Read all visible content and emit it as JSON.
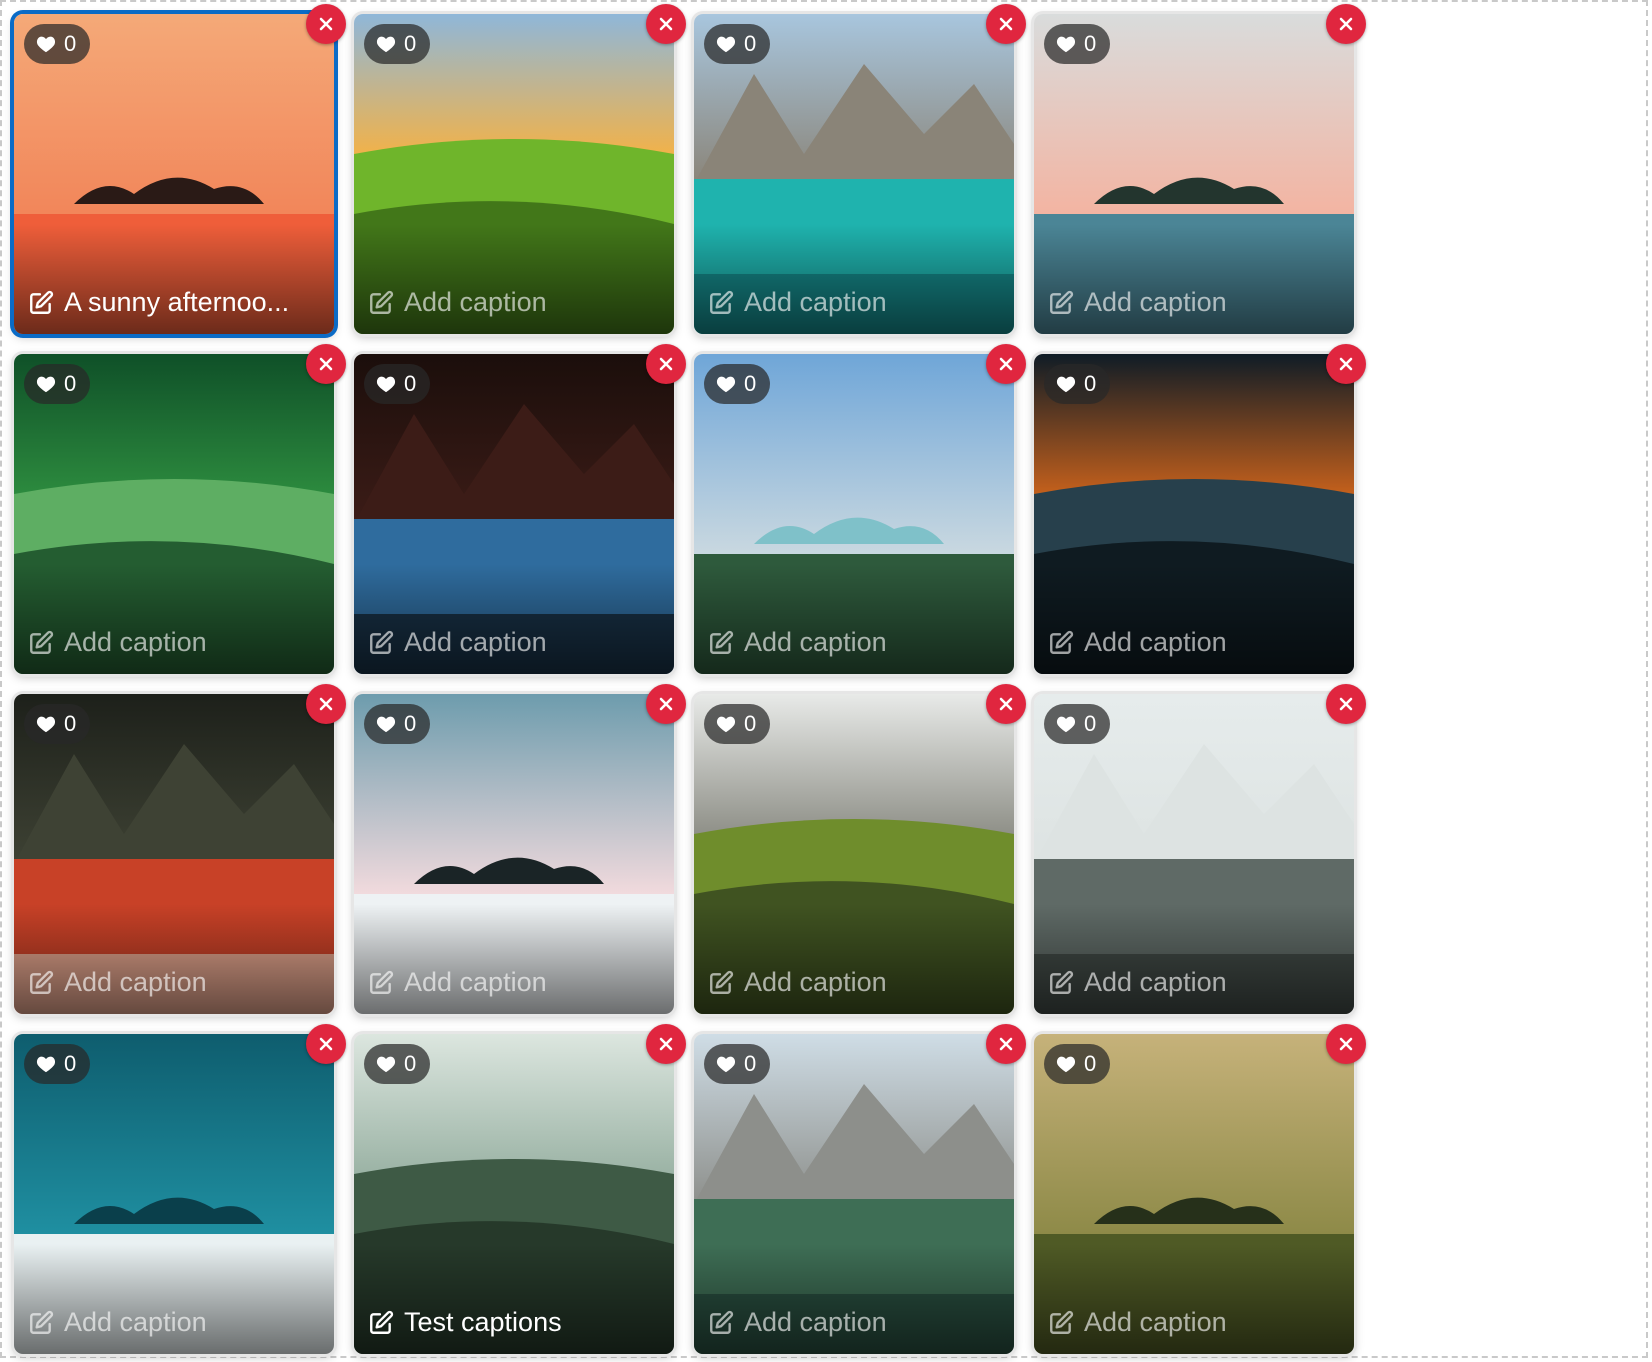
{
  "gallery": {
    "items": [
      {
        "likes": "0",
        "caption": "A sunny afternoo...",
        "has_caption": true,
        "selected": true,
        "scene": "sunset-lake",
        "colors": [
          "#f4a978",
          "#f2865a",
          "#ef5e3a",
          "#2a1a16"
        ]
      },
      {
        "likes": "0",
        "caption": "Add caption",
        "has_caption": false,
        "selected": false,
        "scene": "green-valley",
        "colors": [
          "#8fb7d9",
          "#f1b24a",
          "#6fb52b",
          "#2f5c12"
        ]
      },
      {
        "likes": "0",
        "caption": "Add caption",
        "has_caption": false,
        "selected": false,
        "scene": "alpine-lake",
        "colors": [
          "#a8c6de",
          "#8a8478",
          "#1fb3ae",
          "#0f6d71"
        ]
      },
      {
        "likes": "0",
        "caption": "Add caption",
        "has_caption": false,
        "selected": false,
        "scene": "river-dawn",
        "colors": [
          "#d9dcdc",
          "#f3b4a2",
          "#4b8596",
          "#23352e"
        ]
      },
      {
        "likes": "0",
        "caption": "Add caption",
        "has_caption": false,
        "selected": false,
        "scene": "leaf-drop",
        "colors": [
          "#0f5028",
          "#2c8a3e",
          "#5eae63",
          "#0b3a1d"
        ]
      },
      {
        "likes": "0",
        "caption": "Add caption",
        "has_caption": false,
        "selected": false,
        "scene": "canyon-stars",
        "colors": [
          "#1b0e0b",
          "#3c1c17",
          "#2f6c9e",
          "#0a0a0c"
        ]
      },
      {
        "likes": "0",
        "caption": "Add caption",
        "has_caption": false,
        "selected": false,
        "scene": "mountain-river",
        "colors": [
          "#6fa6d8",
          "#c9d8e0",
          "#2e5a3c",
          "#7fc1c9"
        ]
      },
      {
        "likes": "0",
        "caption": "Add caption",
        "has_caption": false,
        "selected": false,
        "scene": "storm-clouds",
        "colors": [
          "#0f1c26",
          "#c4601c",
          "#27404c",
          "#050b10"
        ]
      },
      {
        "likes": "0",
        "caption": "Add caption",
        "has_caption": false,
        "selected": false,
        "scene": "mushroom",
        "colors": [
          "#1d201a",
          "#3e4234",
          "#c84127",
          "#f1e3cf"
        ]
      },
      {
        "likes": "0",
        "caption": "Add caption",
        "has_caption": false,
        "selected": false,
        "scene": "snow-peaks",
        "colors": [
          "#6d9cad",
          "#f1dadd",
          "#eef2f4",
          "#1a2426"
        ]
      },
      {
        "likes": "0",
        "caption": "Add caption",
        "has_caption": false,
        "selected": false,
        "scene": "green-ridge",
        "colors": [
          "#e8eae8",
          "#8f9088",
          "#6f8d2c",
          "#2c3a1c"
        ]
      },
      {
        "likes": "0",
        "caption": "Add caption",
        "has_caption": false,
        "selected": false,
        "scene": "foggy-forest",
        "colors": [
          "#e6ecec",
          "#dde3e2",
          "#5f6a66",
          "#2d3631"
        ]
      },
      {
        "likes": "0",
        "caption": "Add caption",
        "has_caption": false,
        "selected": false,
        "scene": "ocean-shore",
        "colors": [
          "#0e5d6e",
          "#1f8fa1",
          "#e9f1f2",
          "#0a3f4b"
        ]
      },
      {
        "likes": "0",
        "caption": "Test captions",
        "has_caption": true,
        "selected": false,
        "scene": "misty-valley",
        "colors": [
          "#dce6df",
          "#9bb3a5",
          "#3e5a45",
          "#1d2b20"
        ]
      },
      {
        "likes": "0",
        "caption": "Add caption",
        "has_caption": false,
        "selected": false,
        "scene": "lake-cabin",
        "colors": [
          "#cfdde6",
          "#8d8f8b",
          "#3e6e55",
          "#1d3a32"
        ]
      },
      {
        "likes": "0",
        "caption": "Add caption",
        "has_caption": false,
        "selected": false,
        "scene": "golden-hills",
        "colors": [
          "#c6b27a",
          "#8e8a48",
          "#4f5a25",
          "#26301a"
        ]
      }
    ]
  },
  "icons": {
    "like": "heart-icon",
    "edit": "edit-icon",
    "remove": "close-icon"
  }
}
